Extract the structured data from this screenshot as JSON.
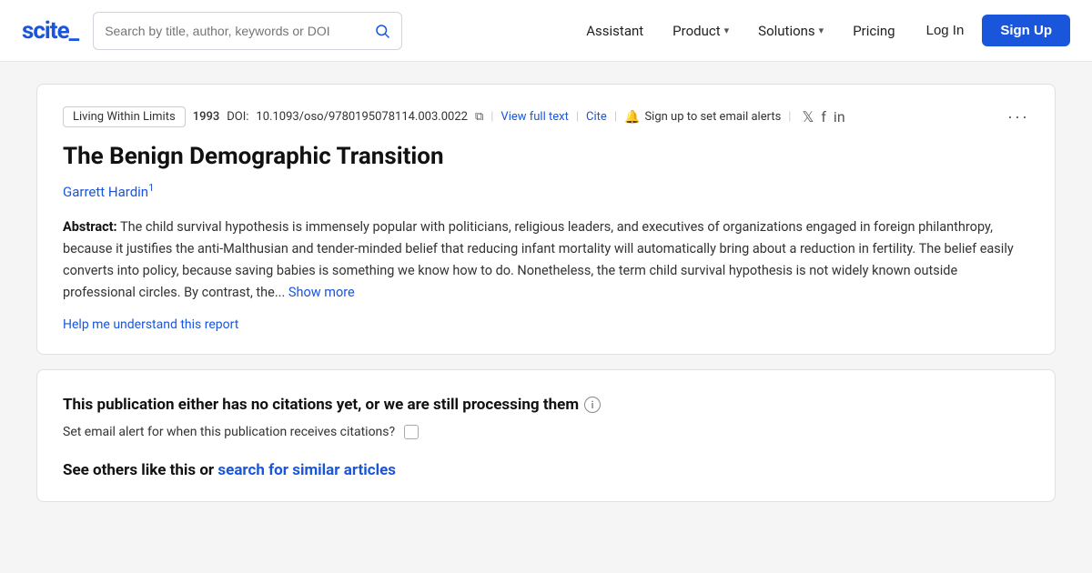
{
  "logo": {
    "text": "scite_"
  },
  "search": {
    "placeholder": "Search by title, author, keywords or DOI"
  },
  "nav": {
    "assistant": "Assistant",
    "product": "Product",
    "solutions": "Solutions",
    "pricing": "Pricing",
    "login": "Log In",
    "signup": "Sign Up"
  },
  "breadcrumb": {
    "tag": "Living Within Limits",
    "year": "1993",
    "doi_label": "DOI:",
    "doi": "10.1093/oso/9780195078114.003.0022",
    "view_full_text": "View full text",
    "cite": "Cite",
    "alert_text": "Sign up to set email alerts"
  },
  "paper": {
    "title": "The Benign Demographic Transition",
    "author": "Garrett Hardin",
    "author_superscript": "1",
    "abstract_label": "Abstract:",
    "abstract_text": "The child survival hypothesis is immensely popular with politicians, religious leaders, and executives of organizations engaged in foreign philanthropy, because it justifies the anti-Malthusian and tender-minded belief that reducing infant mortality will automatically bring about a reduction in fertility. The belief easily converts into policy, because saving babies is something we know how to do. Nonetheless, the term child survival hypothesis is not widely known outside professional circles. By contrast, the...",
    "show_more": "Show more",
    "help_link": "Help me understand this report"
  },
  "citations": {
    "no_citations_text": "This publication either has no citations yet, or we are still processing them",
    "email_alert_label": "Set email alert for when this publication receives citations?",
    "see_others_text": "See others like this or",
    "search_similar_link": "search for similar articles"
  },
  "more_button": "···"
}
